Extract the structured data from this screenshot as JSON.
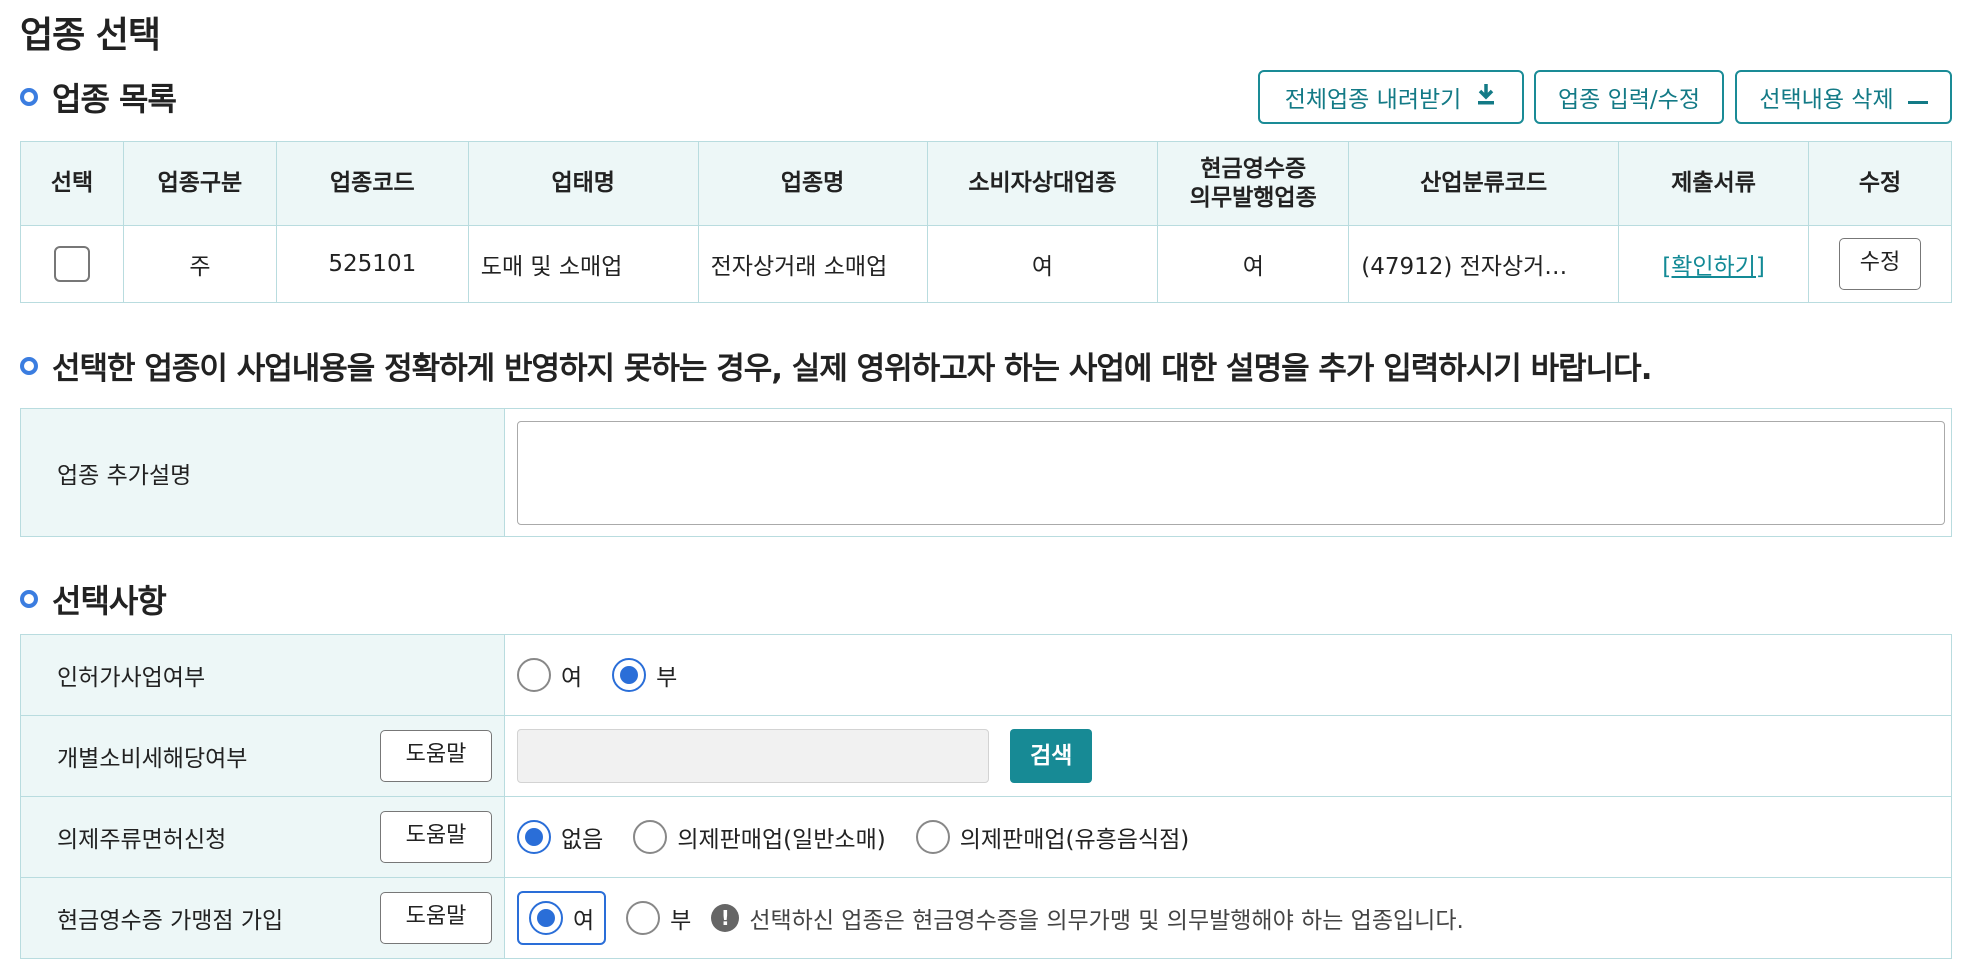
{
  "page": {
    "title": "업종 선택"
  },
  "list_section": {
    "title": "업종 목록",
    "buttons": {
      "download": "전체업종 내려받기",
      "edit_entry": "업종 입력/수정",
      "delete_selected": "선택내용 삭제"
    },
    "columns": {
      "select": "선택",
      "type": "업종구분",
      "code": "업종코드",
      "business_form": "업태명",
      "industry_name": "업종명",
      "consumer": "소비자상대업종",
      "cash_receipt_l1": "현금영수증",
      "cash_receipt_l2": "의무발행업종",
      "industry_class": "산업분류코드",
      "documents": "제출서류",
      "edit": "수정"
    },
    "rows": [
      {
        "type": "주",
        "code": "525101",
        "business_form": "도매 및 소매업",
        "industry_name": "전자상거래 소매업",
        "consumer": "여",
        "cash_receipt": "여",
        "industry_class": "(47912) 전자상거…",
        "documents_link": "[확인하기]",
        "edit_button": "수정"
      }
    ]
  },
  "desc_section": {
    "title": "선택한 업종이 사업내용을 정확하게 반영하지 못하는 경우, 실제 영위하고자 하는 사업에 대한 설명을 추가 입력하시기 바랍니다.",
    "label": "업종 추가설명",
    "value": ""
  },
  "options_section": {
    "title": "선택사항",
    "help_label": "도움말",
    "license": {
      "label": "인허가사업여부",
      "yes": "여",
      "no": "부",
      "selected": "no"
    },
    "excise": {
      "label": "개별소비세해당여부",
      "search_value": "",
      "search_button": "검색"
    },
    "liquor": {
      "label": "의제주류면허신청",
      "options": [
        "없음",
        "의제판매업(일반소매)",
        "의제판매업(유흥음식점)"
      ],
      "selected": "없음"
    },
    "cash_receipt": {
      "label": "현금영수증 가맹점 가입",
      "yes": "여",
      "no": "부",
      "selected": "yes",
      "notice": "선택하신 업종은 현금영수증을 의무가맹 및 의무발행해야 하는 업종입니다."
    }
  },
  "colors": {
    "accent": "#178a95",
    "radio": "#2a6ed8",
    "header_bg": "#edf7f7"
  },
  "icons": {
    "download": "download-icon",
    "minus": "minus-icon",
    "notice": "exclamation-icon"
  }
}
